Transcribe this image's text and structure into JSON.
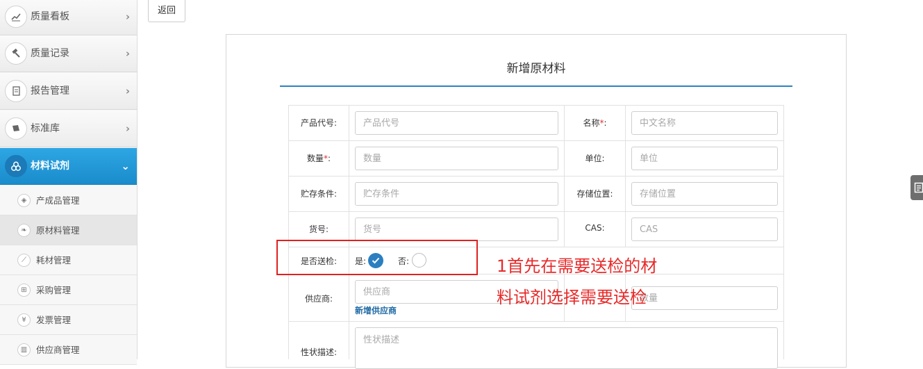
{
  "sidebar": {
    "menu": [
      {
        "label": "质量看板",
        "icon": "chart-line-icon"
      },
      {
        "label": "质量记录",
        "icon": "hammer-icon"
      },
      {
        "label": "报告管理",
        "icon": "document-icon"
      },
      {
        "label": "标准库",
        "icon": "book-icon"
      },
      {
        "label": "材料试剂",
        "icon": "cubes-icon"
      }
    ],
    "submenu": [
      {
        "label": "产成品管理",
        "icon": "cube-icon"
      },
      {
        "label": "原材料管理",
        "icon": "leaf-icon"
      },
      {
        "label": "耗材管理",
        "icon": "dropper-icon"
      },
      {
        "label": "采购管理",
        "icon": "cart-icon"
      },
      {
        "label": "发票管理",
        "icon": "yen-icon"
      },
      {
        "label": "供应商管理",
        "icon": "building-icon"
      }
    ],
    "active_menu": "材料试剂",
    "selected_submenu": "原材料管理",
    "accent_color": "#1a8ccc"
  },
  "toolbar": {
    "back_label": "返回"
  },
  "form": {
    "title": "新增原材料",
    "fields": {
      "product_code": {
        "label": "产品代号:",
        "placeholder": "产品代号"
      },
      "name": {
        "label": "名称",
        "required_mark": "*",
        "suffix": ":",
        "placeholder": "中文名称"
      },
      "quantity": {
        "label": "数量",
        "required_mark": "*",
        "suffix": ":",
        "placeholder": "数量"
      },
      "unit": {
        "label": "单位:",
        "placeholder": "单位"
      },
      "storage_condition": {
        "label": "贮存条件:",
        "placeholder": "贮存条件"
      },
      "storage_location": {
        "label": "存储位置:",
        "placeholder": "存储位置"
      },
      "item_number": {
        "label": "货号:",
        "placeholder": "货号"
      },
      "cas": {
        "label": "CAS:",
        "placeholder": "CAS"
      },
      "inspection": {
        "label": "是否送检:",
        "yes_label": "是:",
        "no_label": "否:",
        "selected": "是"
      },
      "supplier": {
        "label": "供应商:",
        "placeholder": "供应商",
        "add_link": "新增供应商"
      },
      "hidden_field": {
        "placeholder": "数量"
      },
      "description": {
        "label": "性状描述:",
        "placeholder": "性状描述"
      }
    }
  },
  "annotation": {
    "line1": "1首先在需要送检的材",
    "line2": "料试剂选择需要送检",
    "color": "#e82a2a"
  },
  "widget": {
    "icon": "note-icon"
  }
}
